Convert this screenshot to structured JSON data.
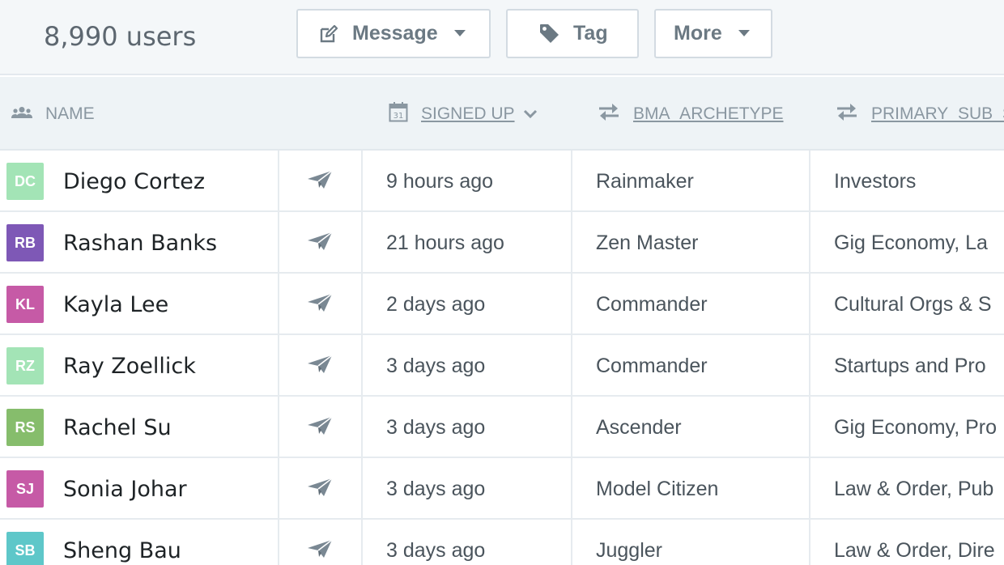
{
  "toolbar": {
    "user_count": "8,990 users",
    "message_label": "Message",
    "tag_label": "Tag",
    "more_label": "More"
  },
  "columns": {
    "name": "NAME",
    "signed_up": "SIGNED UP",
    "bma_archetype": "BMA_ARCHETYPE",
    "primary_sub": "PRIMARY_SUB_S"
  },
  "colors": {
    "toolbar_bg": "#f4f7f9",
    "header_bg": "#eef3f6",
    "icon_gray": "#6b7983"
  },
  "rows": [
    {
      "initials": "DC",
      "avatar_color": "#a3e4b6",
      "name": "Diego Cortez",
      "signed_up": "9 hours ago",
      "archetype": "Rainmaker",
      "primary_sub": "Investors"
    },
    {
      "initials": "RB",
      "avatar_color": "#7e58b6",
      "name": "Rashan Banks",
      "signed_up": "21 hours ago",
      "archetype": "Zen Master",
      "primary_sub": "Gig Economy, La"
    },
    {
      "initials": "KL",
      "avatar_color": "#c65aa6",
      "name": "Kayla Lee",
      "signed_up": "2 days ago",
      "archetype": "Commander",
      "primary_sub": "Cultural Orgs & S"
    },
    {
      "initials": "RZ",
      "avatar_color": "#a3e4b6",
      "name": "Ray Zoellick",
      "signed_up": "3 days ago",
      "archetype": "Commander",
      "primary_sub": "Startups and Pro"
    },
    {
      "initials": "RS",
      "avatar_color": "#86bd6c",
      "name": "Rachel Su",
      "signed_up": "3 days ago",
      "archetype": "Ascender",
      "primary_sub": "Gig Economy, Pro"
    },
    {
      "initials": "SJ",
      "avatar_color": "#c65aa6",
      "name": "Sonia Johar",
      "signed_up": "3 days ago",
      "archetype": "Model Citizen",
      "primary_sub": "Law & Order, Pub"
    },
    {
      "initials": "SB",
      "avatar_color": "#5ec7c9",
      "name": "Sheng Bau",
      "signed_up": "3 days ago",
      "archetype": "Juggler",
      "primary_sub": "Law & Order, Dire"
    }
  ]
}
